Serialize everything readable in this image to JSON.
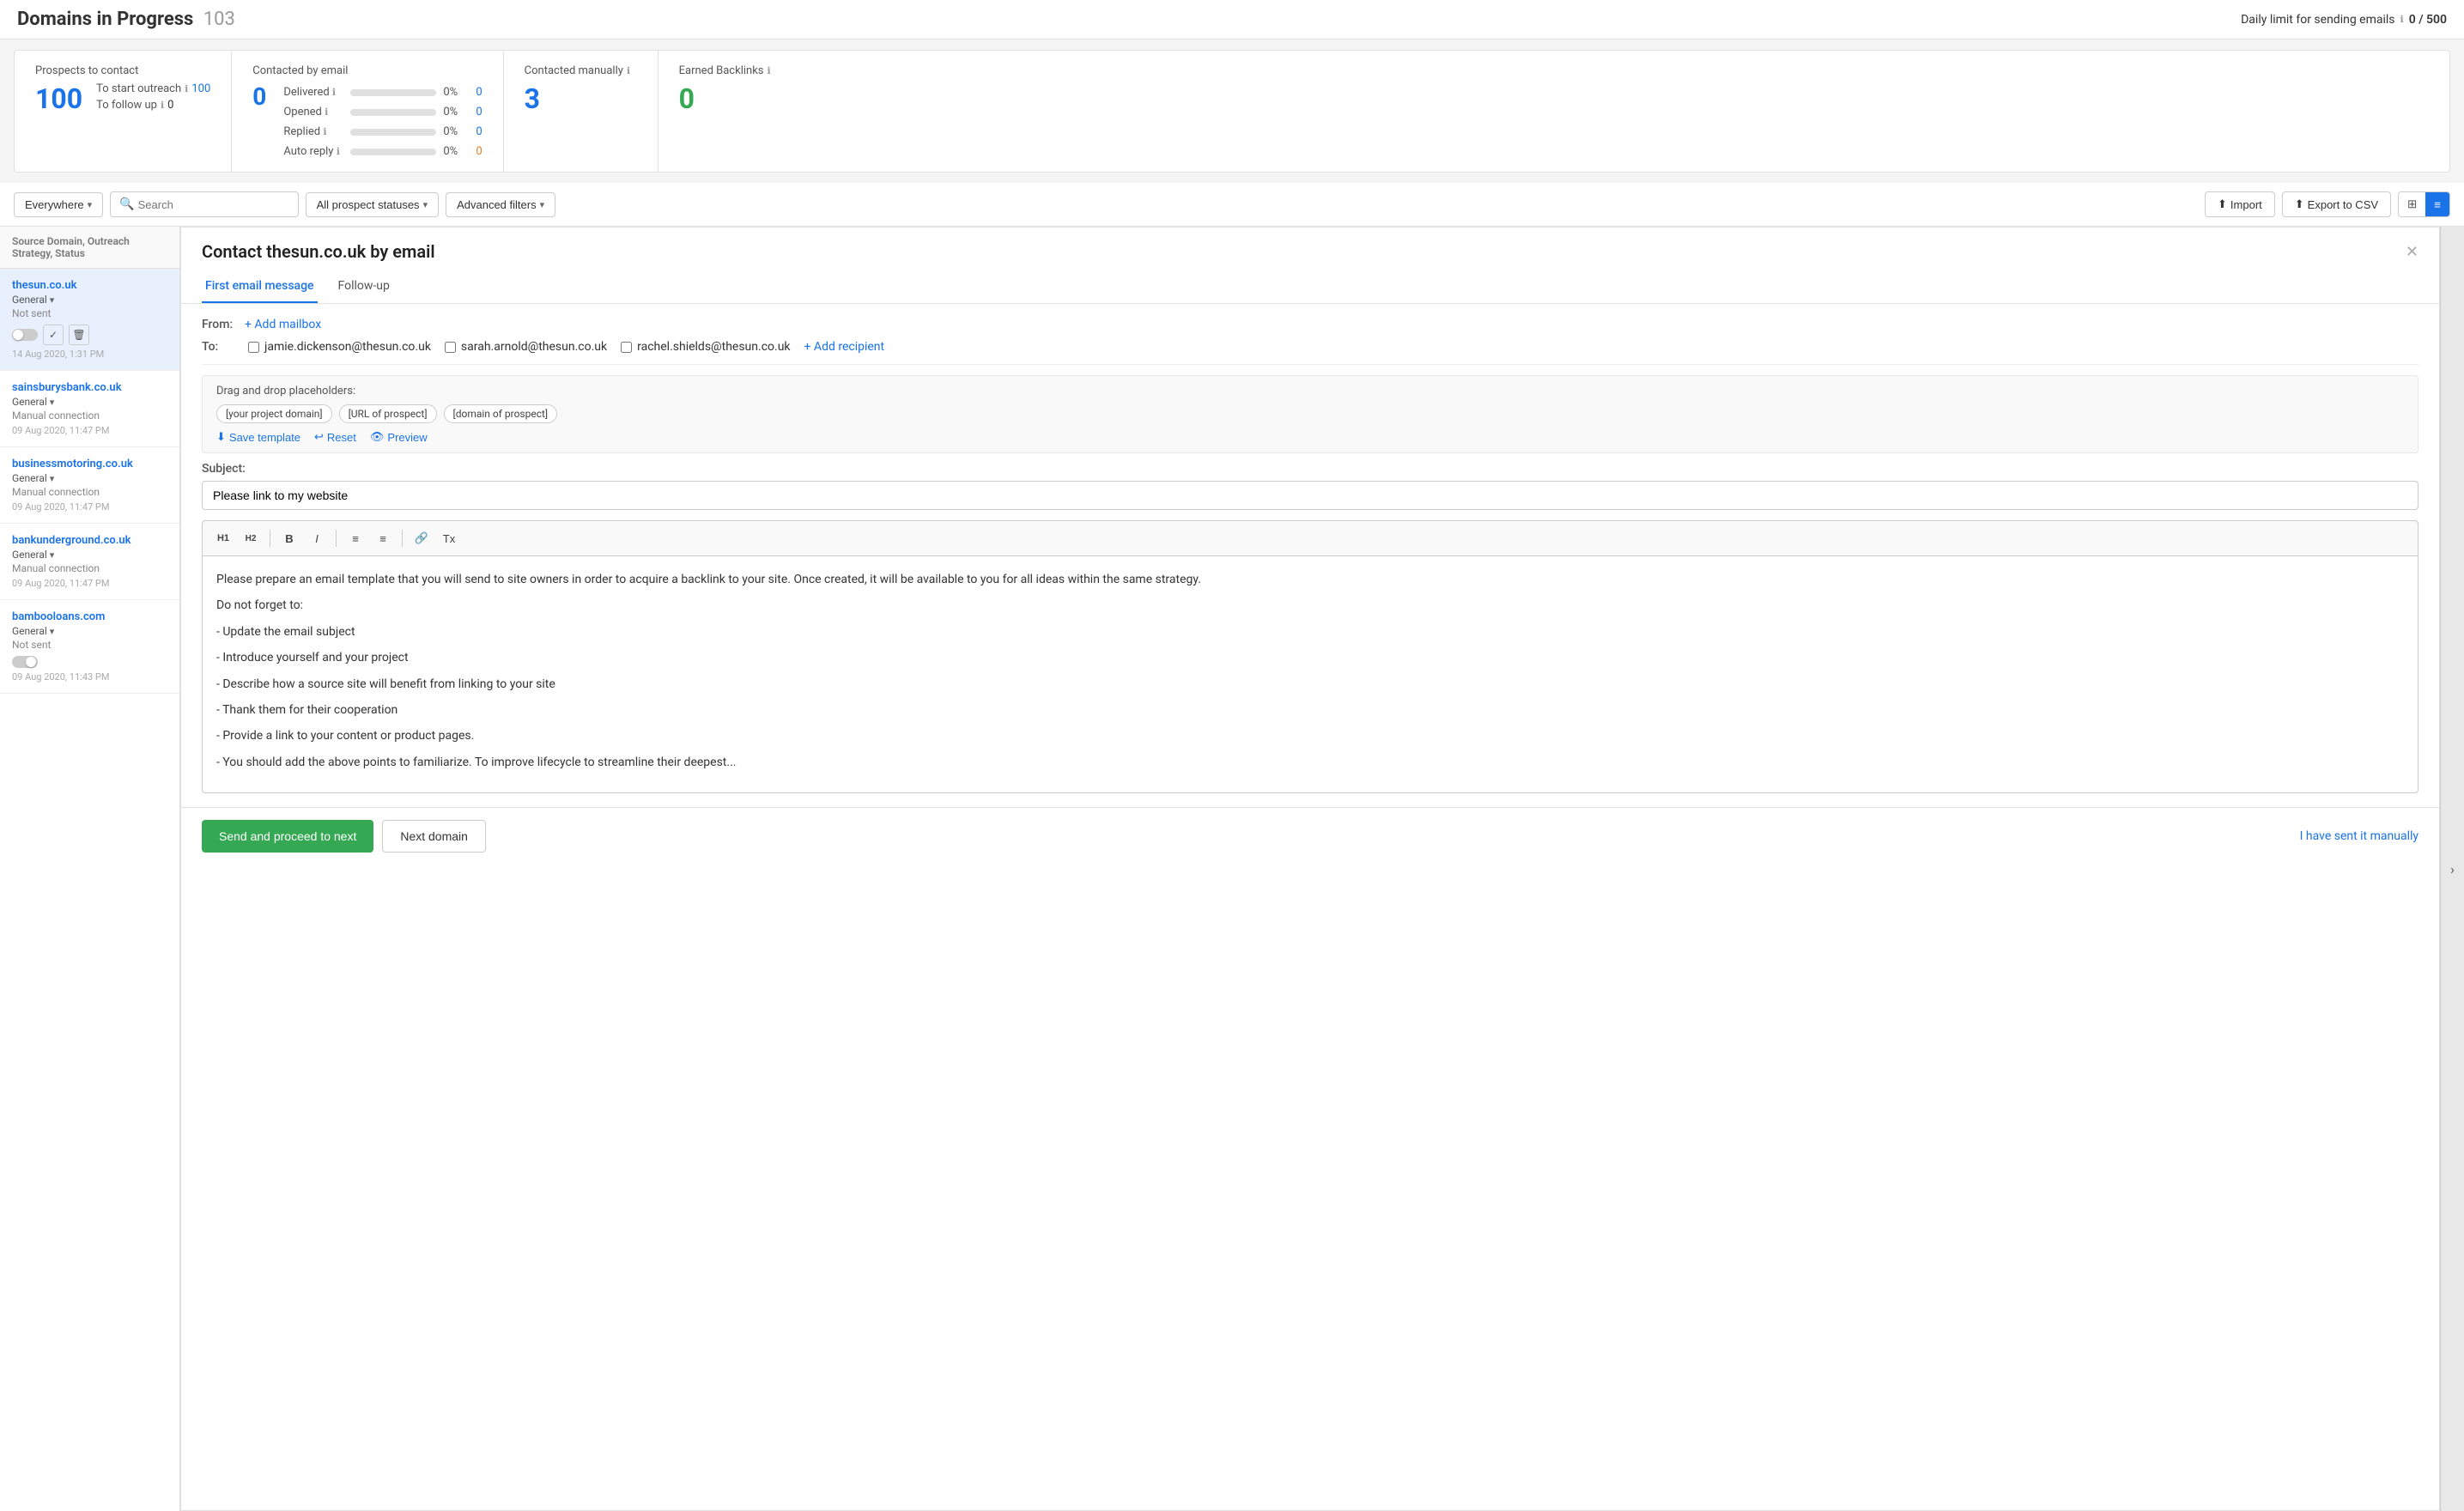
{
  "header": {
    "title": "Domains in Progress",
    "count": "103",
    "daily_limit_label": "Daily limit for sending emails",
    "daily_limit_info": "ℹ",
    "daily_limit_value": "0 / 500"
  },
  "stats": {
    "prospects": {
      "label": "Prospects to contact",
      "big_number": "100",
      "start_outreach_label": "To start outreach",
      "start_outreach_info": "ℹ",
      "start_outreach_value": "100",
      "follow_up_label": "To follow up",
      "follow_up_info": "ℹ",
      "follow_up_value": "0"
    },
    "email": {
      "label": "Contacted by email",
      "big_number": "0",
      "rows": [
        {
          "name": "Delivered",
          "pct": "0%",
          "val": "0",
          "orange": false
        },
        {
          "name": "Opened",
          "pct": "0%",
          "val": "0",
          "orange": false
        },
        {
          "name": "Replied",
          "pct": "0%",
          "val": "0",
          "orange": false
        },
        {
          "name": "Auto reply",
          "pct": "0%",
          "val": "0",
          "orange": true
        }
      ]
    },
    "manual": {
      "label": "Contacted manually",
      "info": "ℹ",
      "big_number": "3"
    },
    "backlinks": {
      "label": "Earned Backlinks",
      "info": "ℹ",
      "big_number": "0"
    }
  },
  "toolbar": {
    "location_label": "Everywhere",
    "search_placeholder": "Search",
    "status_label": "All prospect statuses",
    "filters_label": "Advanced filters",
    "import_label": "Import",
    "export_label": "Export to CSV"
  },
  "sidebar": {
    "header": "Source Domain, Outreach Strategy, Status",
    "items": [
      {
        "domain": "thesun.co.uk",
        "strategy": "General",
        "status": "Not sent",
        "date": "14 Aug 2020, 1:31 PM",
        "has_toggle": true,
        "active": true
      },
      {
        "domain": "sainsburysbank.co.uk",
        "strategy": "General",
        "status": "Manual connection",
        "date": "09 Aug 2020, 11:47 PM",
        "has_toggle": false,
        "active": false
      },
      {
        "domain": "businessmotoring.co.uk",
        "strategy": "General",
        "status": "Manual connection",
        "date": "09 Aug 2020, 11:47 PM",
        "has_toggle": false,
        "active": false
      },
      {
        "domain": "bankunderground.co.uk",
        "strategy": "General",
        "status": "Manual connection",
        "date": "09 Aug 2020, 11:47 PM",
        "has_toggle": false,
        "active": false
      },
      {
        "domain": "bambooloans.com",
        "strategy": "General",
        "status": "Not sent",
        "date": "09 Aug 2020, 11:43 PM",
        "has_toggle": true,
        "active": false
      }
    ]
  },
  "email_panel": {
    "title": "Contact thesun.co.uk by email",
    "tabs": [
      "First email message",
      "Follow-up"
    ],
    "active_tab": 0,
    "from_label": "From:",
    "add_mailbox_label": "+ Add mailbox",
    "to_label": "To:",
    "recipients": [
      "jamie.dickenson@thesun.co.uk",
      "sarah.arnold@thesun.co.uk",
      "rachel.shields@thesun.co.uk"
    ],
    "add_recipient_label": "+ Add recipient",
    "placeholder_label": "Drag and drop placeholders:",
    "placeholders": [
      "[your project domain]",
      "[URL of prospect]",
      "[domain of prospect]"
    ],
    "save_template_label": "Save template",
    "reset_label": "Reset",
    "preview_label": "Preview",
    "subject_label": "Subject:",
    "subject_value": "Please link to my website",
    "editor_content": [
      "Please prepare an email template that you will send to site owners in order to acquire a backlink to your site. Once created, it will be available to you for all ideas within the same strategy.",
      "Do not forget to:",
      "- Update the email subject",
      "- Introduce yourself and your project",
      "- Describe how a source site will benefit from linking to your site",
      "- Thank them for their cooperation",
      "- Provide a link to your content or product pages.",
      "- You should add the above points to familiarize. To improve lifecycle to streamline their deepest..."
    ],
    "send_btn_label": "Send and proceed to next",
    "next_btn_label": "Next domain",
    "sent_manually_label": "I have sent it manually"
  }
}
